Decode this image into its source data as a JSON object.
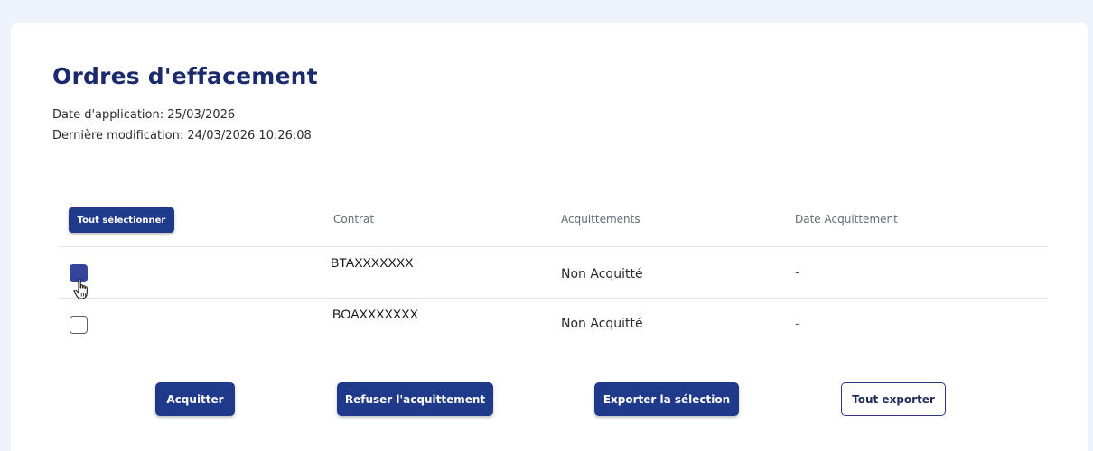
{
  "header": {
    "title": "Ordres d'effacement",
    "application_date": "Date d'application: 25/03/2026",
    "last_modified": "Dernière modification: 24/03/2026 10:26:08"
  },
  "table": {
    "select_all_label": "Tout sélectionner",
    "columns": [
      "Contrat",
      "Acquittements",
      "Date Acquittement"
    ],
    "rows": [
      {
        "contract": "BTAXXXXXXX",
        "status": "Non Acquitté",
        "date": "-",
        "checked": true
      },
      {
        "contract": "BOAXXXXXXX",
        "status": "Non Acquitté",
        "date": "-",
        "checked": false
      }
    ]
  },
  "actions": {
    "acknowledge": "Acquitter",
    "refuse": "Refuser l'acquittement",
    "export_selection": "Exporter la sélection",
    "export_all": "Tout exporter"
  },
  "colors": {
    "primary": "#1f3a8a",
    "title": "#1a2a6c",
    "background": "#eef2fa",
    "checkbox_checked": "#34439b"
  },
  "icons": {
    "cursor": "hand-pointer-icon"
  }
}
